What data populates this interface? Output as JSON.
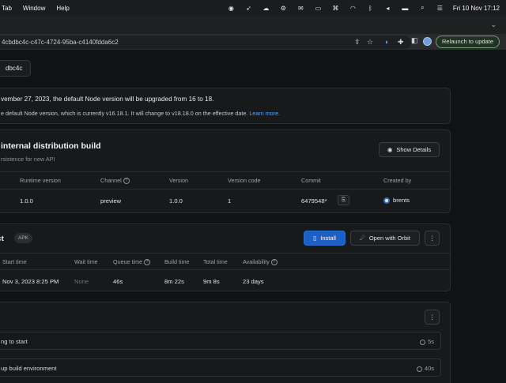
{
  "menubar": {
    "items": [
      "Tab",
      "Window",
      "Help"
    ],
    "clock": "Fri 10 Nov  17:12"
  },
  "browser": {
    "url": "4cbdbc4c-c47c-4724-95ba-c4140fdda6c2",
    "relaunch_label": "Relaunch to update"
  },
  "page": {
    "breadcrumb_pill": "dbc4c",
    "notice": {
      "line1": "vember 27, 2023, the default Node version will be upgraded from 16 to 18.",
      "line2": "e default Node version, which is currently v16.18.1. It will change to v18.18.0 on the effective date.",
      "learn_more": "Learn more."
    },
    "build": {
      "title": "internal distribution build",
      "subtitle": "rsistence for new API",
      "show_details": "Show Details",
      "columns": [
        "Runtime version",
        "Channel",
        "Version",
        "Version code",
        "Commit",
        "Created by"
      ],
      "row": {
        "runtime_version": "1.0.0",
        "channel": "preview",
        "version": "1.0.0",
        "version_code": "1",
        "commit": "6479548*",
        "created_by": "brents"
      }
    },
    "artifact": {
      "title": "act",
      "badge": "APK",
      "install": "Install",
      "open_with_orbit": "Open with Orbit",
      "columns": [
        "Start time",
        "Wait time",
        "Queue time",
        "Build time",
        "Total time",
        "Availability"
      ],
      "row": {
        "start_time": "Nov 3, 2023 8:25 PM",
        "wait_time": "None",
        "queue_time": "46s",
        "build_time": "8m 22s",
        "total_time": "9m 8s",
        "availability": "23 days"
      }
    },
    "logs": [
      {
        "name": "ng to start",
        "duration": "5s"
      },
      {
        "name": "up build environment",
        "duration": "40s"
      }
    ]
  },
  "colors": {
    "accent_blue": "#1d5fc2",
    "link_blue": "#58a1ff",
    "relaunch_green": "#6ca56f"
  }
}
